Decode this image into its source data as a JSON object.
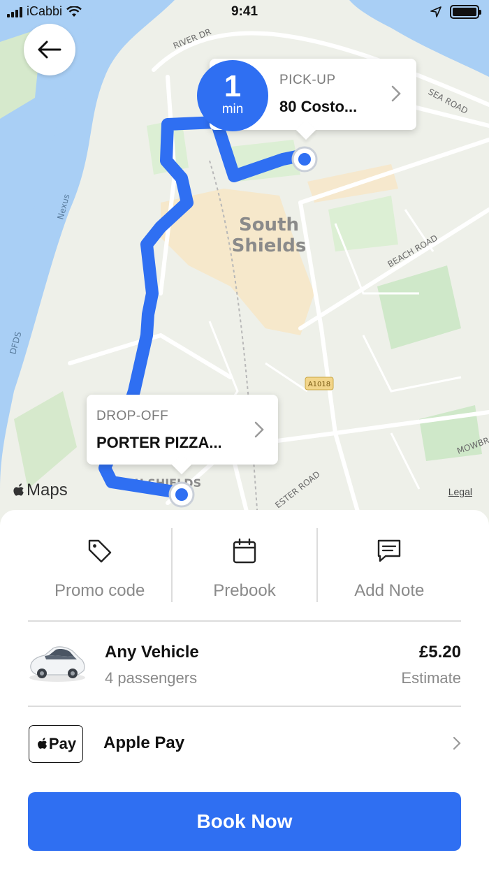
{
  "status_bar": {
    "carrier": "iCabbi",
    "time": "9:41"
  },
  "map": {
    "eta": {
      "value": "1",
      "unit": "min"
    },
    "pickup": {
      "label": "PICK-UP",
      "value": "80 Costo..."
    },
    "dropoff": {
      "label": "DROP-OFF",
      "value": "PORTER PIZZA..."
    },
    "labels": {
      "river_dr": "RIVER DR",
      "sea_road": "SEA ROAD",
      "town": "South Shields",
      "beach_road": "BEACH ROAD",
      "nexus": "Nexus",
      "dfds": "DFDS",
      "a1018": "A1018",
      "high_shields": "HIGH SHIELDS",
      "lester_road": "ESTER ROAD",
      "mowbr": "MOWBR"
    },
    "maps_brand": "Maps",
    "legal": "Legal",
    "colors": {
      "route": "#2f6ff2",
      "water": "#a9cff5",
      "land": "#eef0e9",
      "park": "#cfe8c9"
    }
  },
  "actions": [
    {
      "label": "Promo code",
      "icon": "tag-icon"
    },
    {
      "label": "Prebook",
      "icon": "calendar-icon"
    },
    {
      "label": "Add Note",
      "icon": "note-icon"
    }
  ],
  "vehicle": {
    "name": "Any Vehicle",
    "passengers": "4 passengers",
    "price": "£5.20",
    "price_note": "Estimate"
  },
  "payment": {
    "badge": "Pay",
    "label": "Apple Pay"
  },
  "book_button": "Book Now",
  "accent_color": "#2f6ff2"
}
